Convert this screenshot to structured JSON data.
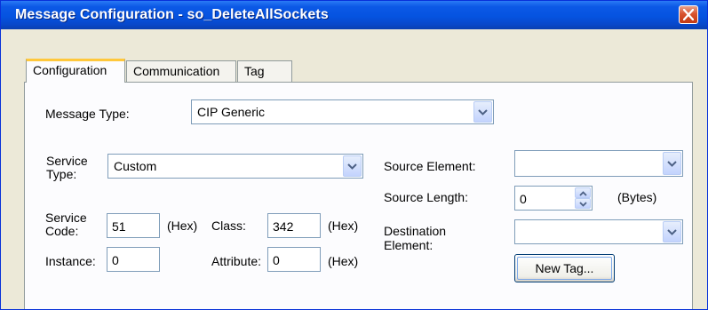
{
  "window": {
    "title": "Message Configuration - so_DeleteAllSockets",
    "close_icon": "close-icon"
  },
  "tabs": [
    {
      "label": "Configuration",
      "active": true
    },
    {
      "label": "Communication",
      "active": false
    },
    {
      "label": "Tag",
      "active": false
    }
  ],
  "form": {
    "message_type_label": "Message Type:",
    "message_type_value": "CIP Generic",
    "service_type_label_line1": "Service",
    "service_type_label_line2": "Type:",
    "service_type_value": "Custom",
    "service_code_label_line1": "Service",
    "service_code_label_line2": "Code:",
    "service_code_value": "51",
    "service_code_unit": "(Hex)",
    "class_label": "Class:",
    "class_value": "342",
    "class_unit": "(Hex)",
    "instance_label": "Instance:",
    "instance_value": "0",
    "attribute_label": "Attribute:",
    "attribute_value": "0",
    "attribute_unit": "(Hex)",
    "source_element_label": "Source Element:",
    "source_element_value": "",
    "source_length_label": "Source Length:",
    "source_length_value": "0",
    "source_length_unit": "(Bytes)",
    "destination_label_line1": "Destination",
    "destination_label_line2": "Element:",
    "destination_value": "",
    "new_tag_label": "New Tag..."
  },
  "colors": {
    "titlebar": "#0553E0",
    "dialog_bg": "#ECE9D8",
    "active_tab_accent": "#FFC83C",
    "close_button": "#D8532E"
  }
}
